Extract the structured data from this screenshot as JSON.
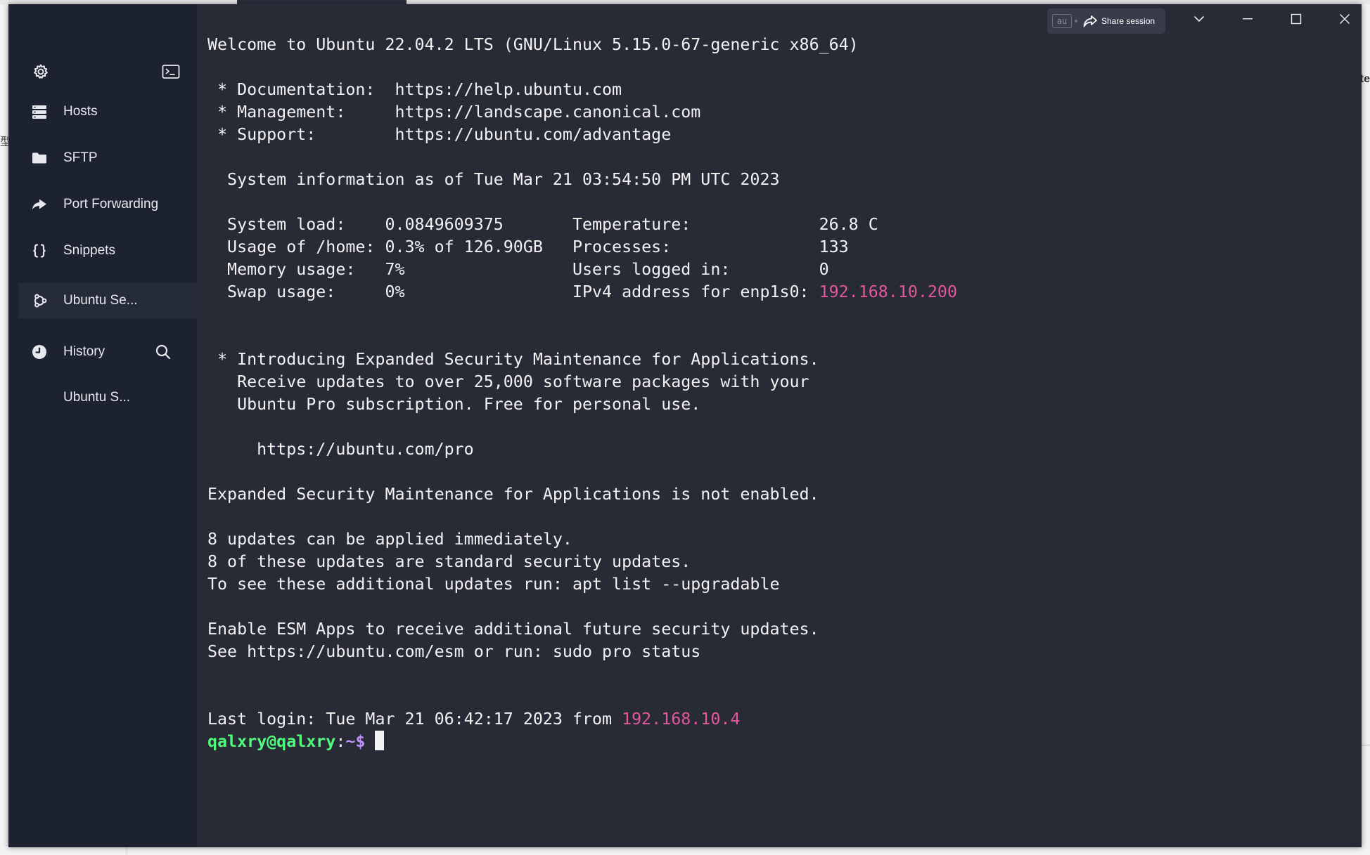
{
  "background": {
    "left_text": "型",
    "right_text": "te"
  },
  "header": {
    "avatar_text": "au",
    "share_label": "Share session"
  },
  "sidebar": {
    "items": [
      {
        "label": "Hosts",
        "icon": "hosts-icon"
      },
      {
        "label": "SFTP",
        "icon": "folder-icon"
      },
      {
        "label": "Port Forwarding",
        "icon": "port-forwarding-icon"
      },
      {
        "label": "Snippets",
        "icon": "snippets-icon"
      },
      {
        "label": "Ubuntu Se...",
        "icon": "ubuntu-icon",
        "active": true
      }
    ],
    "history": {
      "label": "History",
      "entries": [
        {
          "label": "Ubuntu S..."
        }
      ]
    }
  },
  "terminal": {
    "welcome": "Welcome to Ubuntu 22.04.2 LTS (GNU/Linux 5.15.0-67-generic x86_64)",
    "doc_line": " * Documentation:  https://help.ubuntu.com",
    "mgmt_line": " * Management:     https://landscape.canonical.com",
    "support_line": " * Support:        https://ubuntu.com/advantage",
    "sysinfo_line": "  System information as of Tue Mar 21 03:54:50 PM UTC 2023",
    "load_line": "  System load:    0.0849609375       Temperature:             26.8 C",
    "usage_line": "  Usage of /home: 0.3% of 126.90GB   Processes:               133",
    "memory_line": "  Memory usage:   7%                 Users logged in:         0",
    "swap_prefix": "  Swap usage:     0%                 IPv4 address for enp1s0: ",
    "swap_ip": "192.168.10.200",
    "esm_intro_1": " * Introducing Expanded Security Maintenance for Applications.",
    "esm_intro_2": "   Receive updates to over 25,000 software packages with your",
    "esm_intro_3": "   Ubuntu Pro subscription. Free for personal use.",
    "pro_url": "     https://ubuntu.com/pro",
    "esm_disabled": "Expanded Security Maintenance for Applications is not enabled.",
    "updates_1": "8 updates can be applied immediately.",
    "updates_2": "8 of these updates are standard security updates.",
    "updates_3": "To see these additional updates run: apt list --upgradable",
    "enable_1": "Enable ESM Apps to receive additional future security updates.",
    "enable_2": "See https://ubuntu.com/esm or run: sudo pro status",
    "last_login_prefix": "Last login: Tue Mar 21 06:42:17 2023 from ",
    "last_login_ip": "192.168.10.4",
    "prompt_user": "qalxry@qalxry",
    "prompt_sep": ":",
    "prompt_path": "~$",
    "prompt_space": " "
  },
  "colors": {
    "sidebar_bg": "#1d2231",
    "terminal_bg": "#282a36",
    "ip_pink": "#e05a95",
    "prompt_green": "#50fa7b",
    "text": "#f2f2f2"
  }
}
